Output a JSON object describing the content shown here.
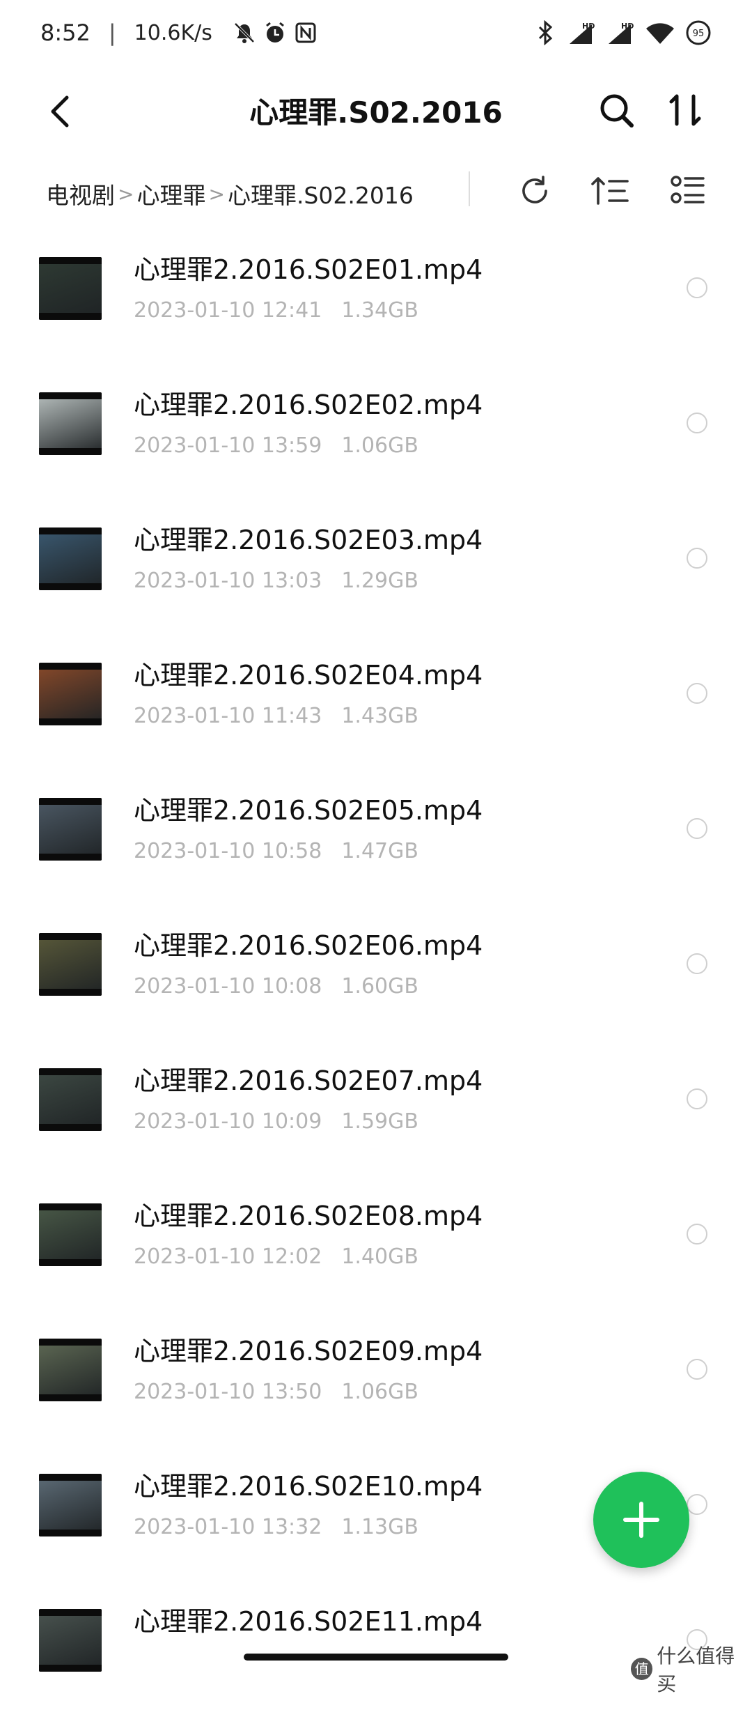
{
  "status_bar": {
    "time": "8:52",
    "separator": "|",
    "net_speed": "10.6K/s",
    "battery": "95",
    "signal_badge_1": "HD",
    "signal_badge_2": "HD"
  },
  "header": {
    "title": "心理罪.S02.2016"
  },
  "breadcrumb": {
    "items": [
      "电视剧",
      "心理罪",
      "心理罪.S02.2016"
    ],
    "separator": ">"
  },
  "files": [
    {
      "name": "心理罪2.2016.S02E01.mp4",
      "date": "2023-01-10 12:41",
      "size": "1.34GB",
      "thumb_color": "#2f3b34"
    },
    {
      "name": "心理罪2.2016.S02E02.mp4",
      "date": "2023-01-10 13:59",
      "size": "1.06GB",
      "thumb_color": "#b9c1c0"
    },
    {
      "name": "心理罪2.2016.S02E03.mp4",
      "date": "2023-01-10 13:03",
      "size": "1.29GB",
      "thumb_color": "#3b5a72"
    },
    {
      "name": "心理罪2.2016.S02E04.mp4",
      "date": "2023-01-10 11:43",
      "size": "1.43GB",
      "thumb_color": "#8a4a2a"
    },
    {
      "name": "心理罪2.2016.S02E05.mp4",
      "date": "2023-01-10 10:58",
      "size": "1.47GB",
      "thumb_color": "#4d5a66"
    },
    {
      "name": "心理罪2.2016.S02E06.mp4",
      "date": "2023-01-10 10:08",
      "size": "1.60GB",
      "thumb_color": "#5a5a3a"
    },
    {
      "name": "心理罪2.2016.S02E07.mp4",
      "date": "2023-01-10 10:09",
      "size": "1.59GB",
      "thumb_color": "#3e4a44"
    },
    {
      "name": "心理罪2.2016.S02E08.mp4",
      "date": "2023-01-10 12:02",
      "size": "1.40GB",
      "thumb_color": "#4a5a48"
    },
    {
      "name": "心理罪2.2016.S02E09.mp4",
      "date": "2023-01-10 13:50",
      "size": "1.06GB",
      "thumb_color": "#5f6a55"
    },
    {
      "name": "心理罪2.2016.S02E10.mp4",
      "date": "2023-01-10 13:32",
      "size": "1.13GB",
      "thumb_color": "#5e6d78"
    },
    {
      "name": "心理罪2.2016.S02E11.mp4",
      "date": "",
      "size": "",
      "thumb_color": "#4a5450"
    }
  ],
  "fab": {
    "icon": "plus-icon",
    "color": "#1fc15a"
  },
  "watermark": {
    "logo": "值",
    "text": "什么值得买"
  }
}
